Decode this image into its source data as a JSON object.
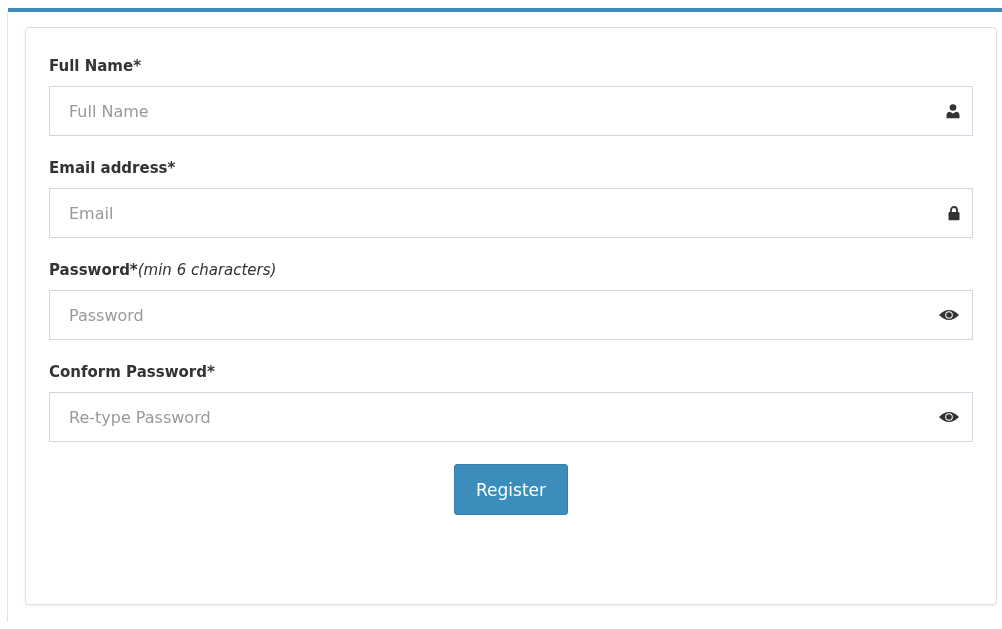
{
  "form": {
    "fields": [
      {
        "kind": "name",
        "label": "Full Name*",
        "placeholder": "Full Name"
      },
      {
        "kind": "email",
        "label": "Email address*",
        "placeholder": "Email"
      },
      {
        "kind": "password",
        "label": "Password*",
        "note": "(min 6 characters)",
        "placeholder": "Password"
      },
      {
        "kind": "password",
        "label": "Conform Password*",
        "placeholder": "Re-type Password"
      }
    ],
    "submit": "Register"
  }
}
